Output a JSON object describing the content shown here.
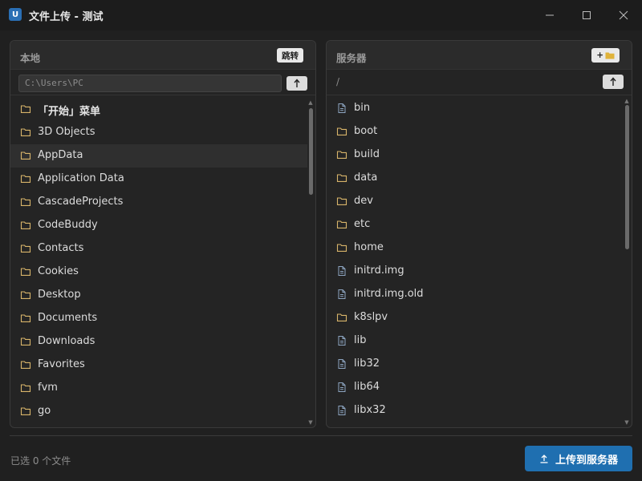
{
  "window": {
    "icon_letter": "U",
    "title": "文件上传 - 测试",
    "min_icon": "minimize-icon",
    "max_icon": "maximize-icon",
    "close_icon": "close-icon"
  },
  "local": {
    "title": "本地",
    "jump_button": "跳转",
    "path": "C:\\Users\\PC",
    "items": [
      {
        "name": "「开始」菜单",
        "type": "folder",
        "bold": true
      },
      {
        "name": "3D Objects",
        "type": "folder"
      },
      {
        "name": "AppData",
        "type": "folder",
        "selected": true
      },
      {
        "name": "Application Data",
        "type": "folder"
      },
      {
        "name": "CascadeProjects",
        "type": "folder"
      },
      {
        "name": "CodeBuddy",
        "type": "folder"
      },
      {
        "name": "Contacts",
        "type": "folder"
      },
      {
        "name": "Cookies",
        "type": "folder"
      },
      {
        "name": "Desktop",
        "type": "folder"
      },
      {
        "name": "Documents",
        "type": "folder"
      },
      {
        "name": "Downloads",
        "type": "folder"
      },
      {
        "name": "Favorites",
        "type": "folder"
      },
      {
        "name": "fvm",
        "type": "folder"
      },
      {
        "name": "go",
        "type": "folder"
      }
    ]
  },
  "server": {
    "title": "服务器",
    "new_folder_button": "+",
    "path": "/",
    "items": [
      {
        "name": "bin",
        "type": "file"
      },
      {
        "name": "boot",
        "type": "folder"
      },
      {
        "name": "build",
        "type": "folder"
      },
      {
        "name": "data",
        "type": "folder"
      },
      {
        "name": "dev",
        "type": "folder"
      },
      {
        "name": "etc",
        "type": "folder"
      },
      {
        "name": "home",
        "type": "folder"
      },
      {
        "name": "initrd.img",
        "type": "file"
      },
      {
        "name": "initrd.img.old",
        "type": "file"
      },
      {
        "name": "k8slpv",
        "type": "folder"
      },
      {
        "name": "lib",
        "type": "file"
      },
      {
        "name": "lib32",
        "type": "file"
      },
      {
        "name": "lib64",
        "type": "file"
      },
      {
        "name": "libx32",
        "type": "file"
      }
    ]
  },
  "footer": {
    "status": "已选 0 个文件",
    "upload_label": "上传到服务器"
  },
  "colors": {
    "accent": "#1f6fb0",
    "folder": "#d8b46a",
    "file": "#8ea6c2"
  }
}
